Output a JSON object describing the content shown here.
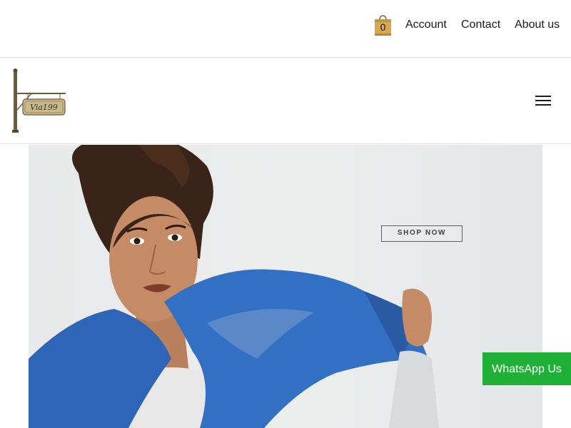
{
  "topbar": {
    "cart_count": "0",
    "links": {
      "account": "Account",
      "contact": "Contact",
      "about": "About us"
    }
  },
  "header": {
    "logo_text": "Via199",
    "menu_icon": "hamburger-menu-icon"
  },
  "hero": {
    "cta_label": "SHOP NOW",
    "image": "woman-with-blue-scarf-photo"
  },
  "whatsapp": {
    "label": "WhatsApp Us"
  },
  "colors": {
    "whatsapp_green": "#20b038",
    "scarf_blue": "#2f65b7",
    "cart_gold": "#d6a94f",
    "text_dark": "#1a1a1a"
  },
  "icons": [
    "shopping-bag-icon",
    "hamburger-menu-icon"
  ]
}
